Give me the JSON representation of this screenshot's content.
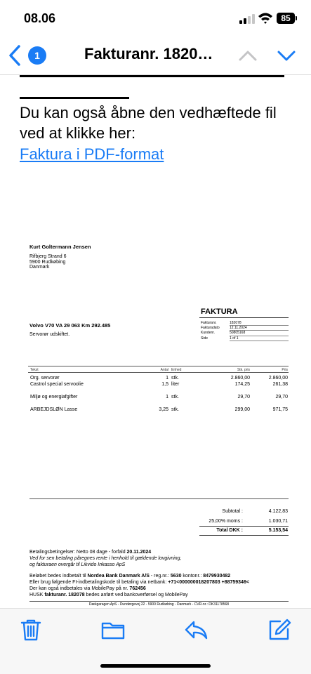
{
  "status": {
    "time": "08.06",
    "battery": "85"
  },
  "nav": {
    "badge": "1",
    "title": "Fakturanr. 1820…"
  },
  "intro": {
    "text": "Du kan også åbne den vedhæftede fil ved at klikke her:",
    "link": "Faktura i PDF-format"
  },
  "invoice": {
    "customer": {
      "name": "Kurt Goltermann Jensen",
      "lines": [
        "Rifbjerg Strand 6",
        "5900 Rudkøbing",
        "Danmark"
      ]
    },
    "title": "FAKTURA",
    "meta": [
      {
        "label": "Fakturanr.",
        "value": "182078"
      },
      {
        "label": "Fakturadato",
        "value": "12.11.2024"
      },
      {
        "label": "Kundenr.",
        "value": "50805168"
      },
      {
        "label": "Side",
        "value": "1 of 1"
      }
    ],
    "vehicle": "Volvo V70 VA 29 063 Km 292.485",
    "note": "Servorør udskiftet.",
    "columns": {
      "text": "Tekst",
      "qty": "Antal",
      "unit": "Enhed",
      "unit_price": "Stk. pris",
      "price": "Pris"
    },
    "rows": [
      {
        "text": "Org. servorør",
        "qty": "1",
        "unit": "stk.",
        "unit_price": "2.860,00",
        "price": "2.860,00"
      },
      {
        "text": "Castrol special servoolie",
        "qty": "1,5",
        "unit": "liter",
        "unit_price": "174,25",
        "price": "261,38"
      },
      {
        "text": "Miljø og energiafgifter",
        "qty": "1",
        "unit": "stk.",
        "unit_price": "29,70",
        "price": "29,70"
      },
      {
        "text": "ARBEJDSLØN Lasse",
        "qty": "3,25",
        "unit": "stk.",
        "unit_price": "299,00",
        "price": "971,75"
      }
    ],
    "totals": {
      "subtotal_label": "Subtotal :",
      "subtotal": "4.122,83",
      "vat_label": "25,00% moms :",
      "vat": "1.030,71",
      "total_label": "Total DKK :",
      "total": "5.153,54"
    },
    "payment": {
      "terms_prefix": "Betalingsbetingelser: Netto 08 dage - forfald ",
      "terms_date": "20.11.2024",
      "interest_1": "Ved for sen betaling påregnes rente i henhold til gældende lovgivning,",
      "interest_2": "og fakturaen overgår til Likvido Inkasso ApS",
      "bank_prefix": "Beløbet bedes indbetalt til ",
      "bank_name": "Nordea Bank Danmark A/S",
      "bank_mid": " - reg.nr.: ",
      "reg": "5630",
      "account_label": " kontonr.: ",
      "account": "8479930482",
      "fi_prefix": "Eller brug følgende FI-indbetalingskode til betaling via netbank: ",
      "fi_code": "+71<000000018207803 +88759346<",
      "mobilepay_prefix": "Der kan også indbetales via MobilePay på nr. ",
      "mobilepay": "762456",
      "remember_prefix": "HUSK ",
      "remember_bold": "fakturanr. 182078",
      "remember_suffix": " bedes anført ved bankoverførsel og MobilePay"
    },
    "footer": "Dækgaragen ApS - Dundørgevej 22 - 5900 Rudkøbing - Danmark - CVR-nr.: DK31178568"
  },
  "toolbar": {
    "icons": [
      "trash-icon",
      "folder-icon",
      "reply-icon",
      "compose-icon"
    ],
    "accent": "#1a7cf5"
  }
}
